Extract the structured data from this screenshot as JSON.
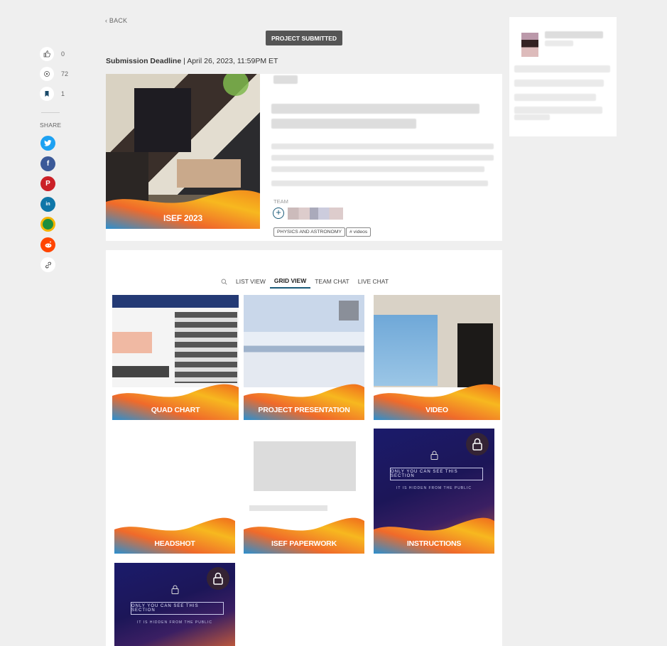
{
  "nav": {
    "back_label": "BACK"
  },
  "status": {
    "submitted_label": "PROJECT SUBMITTED"
  },
  "deadline": {
    "label": "Submission Deadline",
    "separator": " | ",
    "value": "April 26, 2023, 11:59PM ET"
  },
  "stats": {
    "likes": "0",
    "views": "72",
    "saves": "1"
  },
  "share": {
    "label": "SHARE"
  },
  "social_colors": {
    "twitter": "#1da1f2",
    "facebook": "#3b5998",
    "pinterest": "#cb2027",
    "linkedin": "#0e76a8",
    "classroom": "#1e8e3e",
    "reddit": "#ff4500"
  },
  "project": {
    "thumb_label": "ISEF 2023",
    "team_label": "TEAM",
    "tags": [
      "PHYSICS AND ASTRONOMY",
      "# videos"
    ]
  },
  "tabs": [
    "LIST VIEW",
    "GRID VIEW",
    "TEAM CHAT",
    "LIVE CHAT"
  ],
  "active_tab": "GRID VIEW",
  "tiles": [
    {
      "label": "QUAD CHART"
    },
    {
      "label": "PROJECT PRESENTATION"
    },
    {
      "label": "VIDEO"
    },
    {
      "label": "HEADSHOT"
    },
    {
      "label": "ISEF PAPERWORK"
    },
    {
      "label": "INSTRUCTIONS"
    }
  ],
  "hidden": {
    "title": "ONLY YOU CAN SEE THIS SECTION",
    "subtitle": "IT IS HIDDEN FROM THE PUBLIC"
  }
}
